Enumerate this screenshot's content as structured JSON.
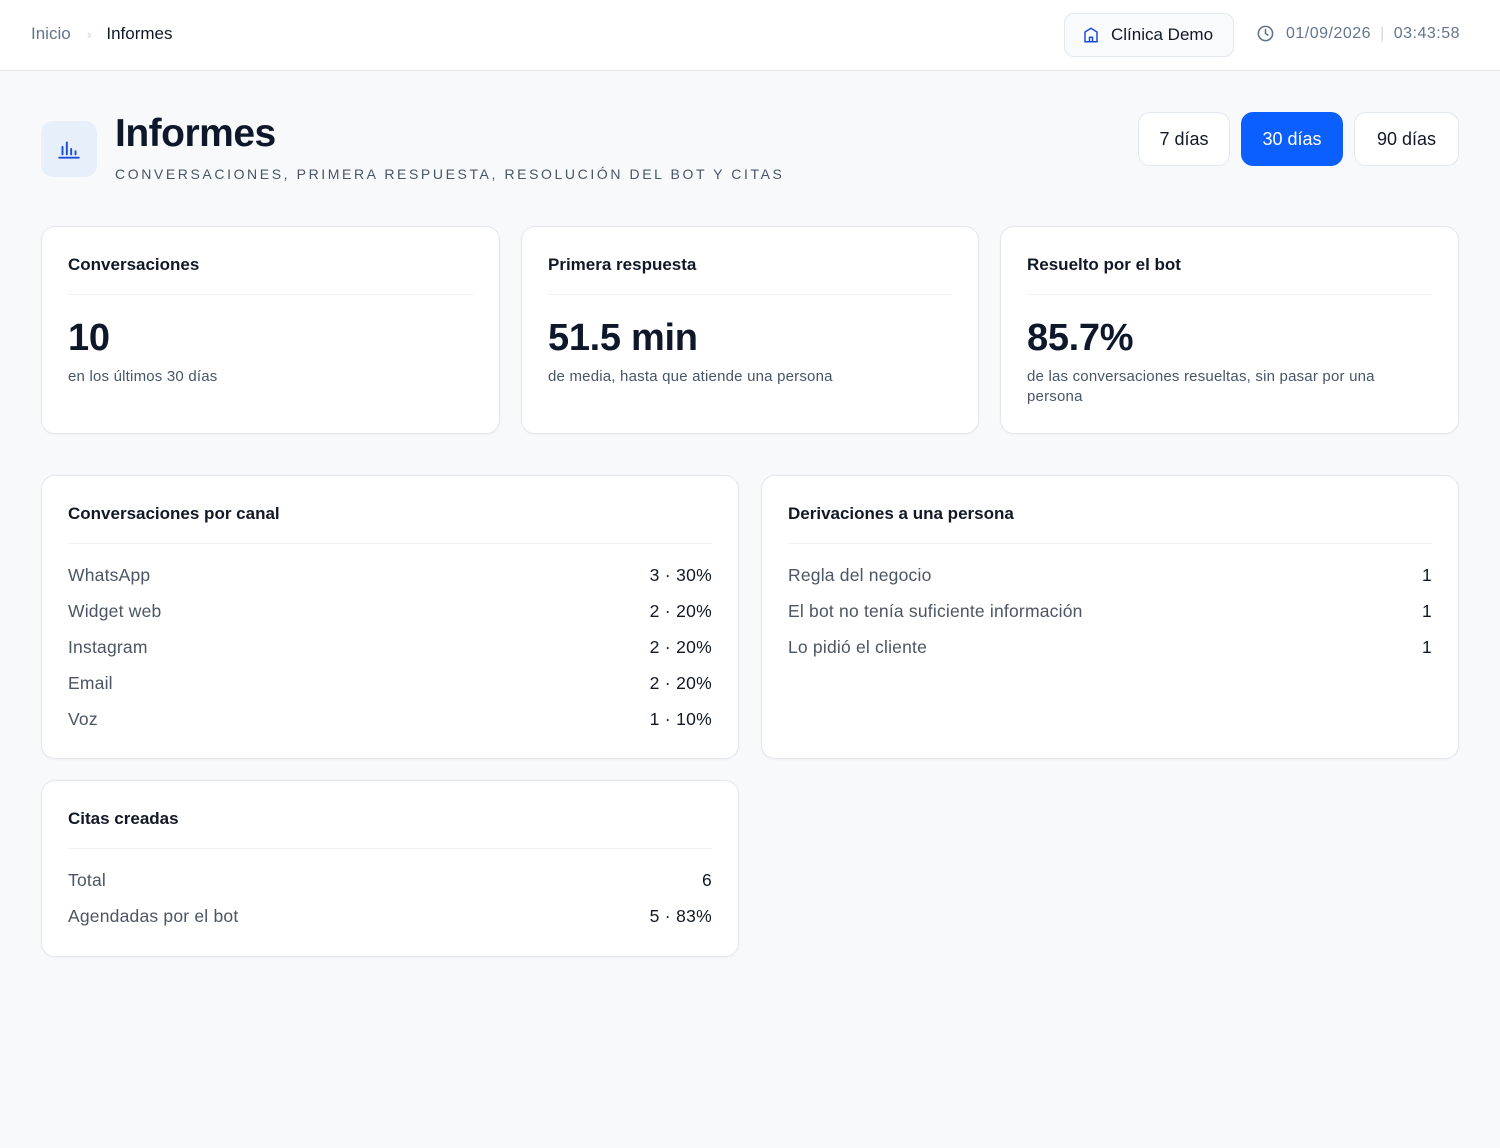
{
  "breadcrumb": {
    "home": "Inicio",
    "separator": "›",
    "current": "Informes"
  },
  "topbar": {
    "clinic_label": "Clínica Demo",
    "clinic_icon": "building-icon",
    "clock_icon": "clock-icon",
    "date": "01/09/2026",
    "time_separator": "|",
    "time": "03:43:58"
  },
  "header": {
    "icon": "bar-chart-icon",
    "title": "Informes",
    "subtitle": "CONVERSACIONES, PRIMERA RESPUESTA, RESOLUCIÓN DEL BOT Y CITAS",
    "ranges": [
      {
        "label": "7 días",
        "active": false
      },
      {
        "label": "30 días",
        "active": true
      },
      {
        "label": "90 días",
        "active": false
      }
    ]
  },
  "kpis": [
    {
      "title": "Conversaciones",
      "value": "10",
      "description": "en los últimos 30 días"
    },
    {
      "title": "Primera respuesta",
      "value": "51.5 min",
      "description": "de media, hasta que atiende una persona"
    },
    {
      "title": "Resuelto por el bot",
      "value": "85.7%",
      "description": "de las conversaciones resueltas, sin pasar por una persona"
    }
  ],
  "channels": {
    "title": "Conversaciones por canal",
    "rows": [
      {
        "label": "WhatsApp",
        "value": "3 · 30%"
      },
      {
        "label": "Widget web",
        "value": "2 · 20%"
      },
      {
        "label": "Instagram",
        "value": "2 · 20%"
      },
      {
        "label": "Email",
        "value": "2 · 20%"
      },
      {
        "label": "Voz",
        "value": "1 · 10%"
      }
    ]
  },
  "handoffs": {
    "title": "Derivaciones a una persona",
    "rows": [
      {
        "label": "Regla del negocio",
        "value": "1"
      },
      {
        "label": "El bot no tenía suficiente información",
        "value": "1"
      },
      {
        "label": "Lo pidió el cliente",
        "value": "1"
      }
    ]
  },
  "appointments": {
    "title": "Citas creadas",
    "rows": [
      {
        "label": "Total",
        "value": "6"
      },
      {
        "label": "Agendadas por el bot",
        "value": "5 · 83%"
      }
    ]
  },
  "colors": {
    "accent": "#0b5fff",
    "icon_blue": "#1d4ed8",
    "background": "#f8f9fb"
  }
}
